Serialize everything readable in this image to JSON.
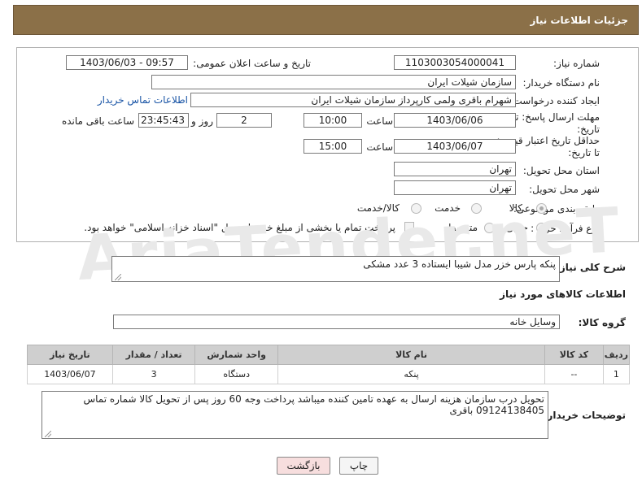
{
  "header": {
    "title": "جزئیات اطلاعات نیاز"
  },
  "form": {
    "need_number_label": "شماره نیاز:",
    "need_number": "1103003054000041",
    "announce_label": "تاریخ و ساعت اعلان عمومی:",
    "announce_value": "1403/06/03 - 09:57",
    "buyer_org_label": "نام دستگاه خریدار:",
    "buyer_org": "سازمان شیلات ایران",
    "requester_label": "ایجاد کننده درخواست:",
    "requester": "شهرام باقری ولمی کارپرداز سازمان شیلات ایران",
    "contact_link": "اطلاعات تماس خریدار",
    "reply_deadline_label": "مهلت ارسال پاسخ: تا تاریخ:",
    "reply_date": "1403/06/06",
    "time_label": "ساعت",
    "reply_time": "10:00",
    "days": "2",
    "days_label": "روز و",
    "remaining_time": "23:45:43",
    "remaining_label": "ساعت باقی مانده",
    "price_validity_label": "حداقل تاریخ اعتبار قیمت: تا تاریخ:",
    "price_date": "1403/06/07",
    "price_time": "15:00",
    "province_label": "استان محل تحویل:",
    "province": "تهران",
    "city_label": "شهر محل تحویل:",
    "city": "تهران",
    "category_label": "طبقه بندی موضوعی:",
    "category_options": [
      "کالا",
      "خدمت",
      "کالا/خدمت"
    ],
    "process_label": "نوع فرآیند خرید :",
    "process_options": [
      "جزیی",
      "متوسط"
    ],
    "payment_note": "پرداخت تمام یا بخشی از مبلغ خرید،از محل \"اسناد خزانه اسلامی\" خواهد بود."
  },
  "description": {
    "label": "شرح کلی نیاز:",
    "value": "پنکه پارس خزر مدل شیبا ایستاده 3 عدد مشکی"
  },
  "goods_section": {
    "title": "اطلاعات کالاهای مورد نیاز",
    "group_label": "گروه کالا:",
    "group_value": "وسایل خانه"
  },
  "table": {
    "headers": [
      "ردیف",
      "کد کالا",
      "نام کالا",
      "واحد شمارش",
      "تعداد / مقدار",
      "تاریخ نیاز"
    ],
    "rows": [
      [
        "1",
        "--",
        "پنکه",
        "دستگاه",
        "3",
        "1403/06/07"
      ]
    ]
  },
  "buyer_notes": {
    "label": "توضیحات خریدار:",
    "value": "تحویل درب سازمان هزینه ارسال به عهده تامین کننده میباشد پرداخت وجه 60 روز پس از تحویل کالا شماره تماس 09124138405 باقری"
  },
  "buttons": {
    "print": "چاپ",
    "back": "بازگشت"
  },
  "watermark": "AriaTender.neT",
  "colors": {
    "header_bg": "#8b7048",
    "back_button_bg": "#f7dede",
    "link": "#1a55a6"
  }
}
